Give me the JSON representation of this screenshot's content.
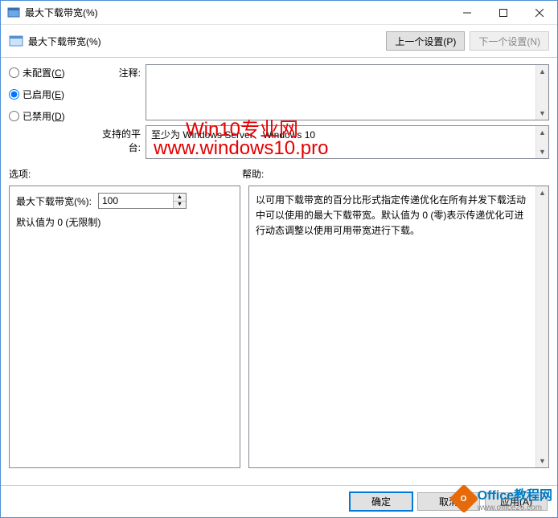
{
  "window": {
    "title": "最大下载带宽(%)"
  },
  "header": {
    "subtitle": "最大下载带宽(%)",
    "prev_button": "上一个设置(P)",
    "next_button": "下一个设置(N)"
  },
  "radios": {
    "not_configured": "未配置(C)",
    "enabled": "已启用(E)",
    "disabled": "已禁用(D)",
    "selected": "enabled"
  },
  "fields": {
    "comment_label": "注释:",
    "comment_value": "",
    "platform_label": "支持的平台:",
    "platform_value": "至少为 Windows Server、Windows 10"
  },
  "sections": {
    "options_label": "选项:",
    "help_label": "帮助:"
  },
  "options": {
    "bandwidth_label": "最大下载带宽(%):",
    "bandwidth_value": "100",
    "default_note": "默认值为 0 (无限制)"
  },
  "help": {
    "text": "以可用下载带宽的百分比形式指定传递优化在所有并发下载活动中可以使用的最大下载带宽。默认值为 0 (零)表示传递优化可进行动态调整以使用可用带宽进行下载。"
  },
  "buttons": {
    "ok": "确定",
    "cancel": "取消",
    "apply": "应用(A)"
  },
  "watermark": {
    "line1": "Win10专业网",
    "line2": "www.windows10.pro",
    "office_text": "Office教程网",
    "office_url": "www.office26.com"
  }
}
